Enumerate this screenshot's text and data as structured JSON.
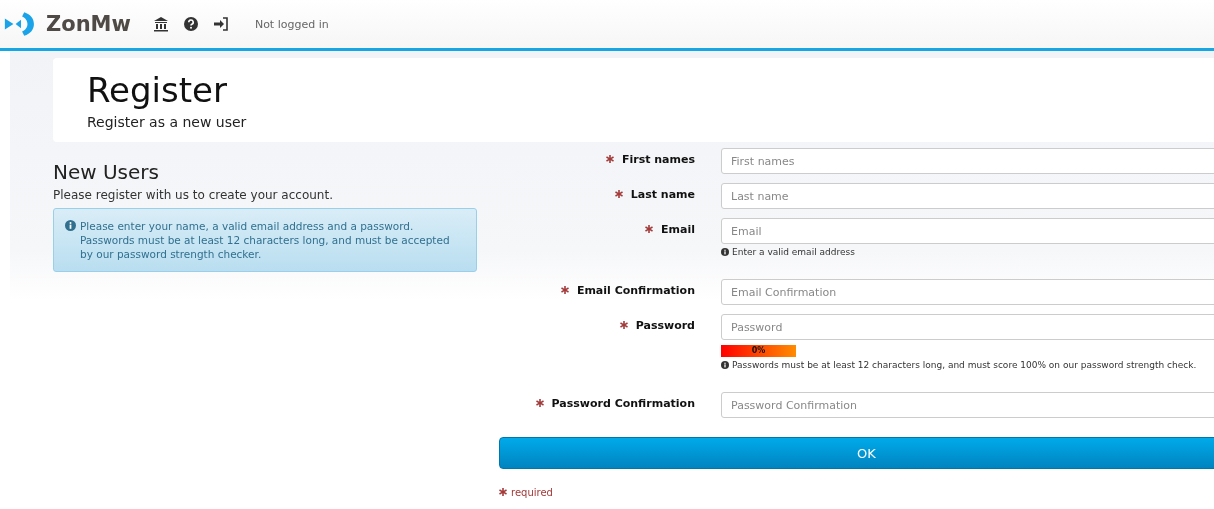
{
  "header": {
    "brand": "ZonMw",
    "status": "Not logged in"
  },
  "page": {
    "title": "Register",
    "subtitle": "Register as a new user"
  },
  "intro": {
    "heading": "New Users",
    "text": "Please register with us to create your account.",
    "info": "Please enter your name, a valid email address and a password. Passwords must be at least 12 characters long, and must be accepted by our password strength checker."
  },
  "fields": [
    {
      "label": "First names",
      "placeholder": "First names",
      "required": true
    },
    {
      "label": "Last name",
      "placeholder": "Last name",
      "required": true
    },
    {
      "label": "Email",
      "placeholder": "Email",
      "required": true,
      "help": "Enter a valid email address"
    },
    {
      "label": "Email Confirmation",
      "placeholder": "Email Confirmation",
      "required": true
    },
    {
      "label": "Password",
      "placeholder": "Password",
      "required": true,
      "meter": "0%",
      "help": "Passwords must be at least 12 characters long, and must score 100% on our password strength check."
    },
    {
      "label": "Password Confirmation",
      "placeholder": "Password Confirmation",
      "required": true
    }
  ],
  "submit": "OK",
  "legend": "required"
}
